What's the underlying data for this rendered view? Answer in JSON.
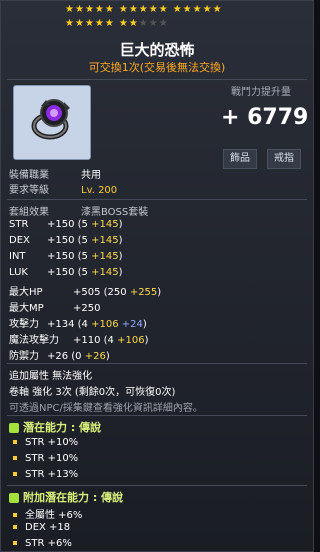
{
  "item": {
    "name": "巨大的恐怖",
    "trade_note": "可交換1次(交易後無法交換)",
    "power_label": "戰鬥力提升量",
    "power_value": "+ 6779",
    "tags": [
      "飾品",
      "戒指"
    ],
    "job_label": "裝備職業",
    "job_value": "共用",
    "level_label": "要求等級",
    "level_value": "Lv. 200"
  },
  "stars": {
    "filled": 22,
    "total": 25,
    "color": "#ffcc22"
  },
  "set": {
    "label": "套組效果",
    "name": "漆黑BOSS套裝"
  },
  "stats": [
    {
      "name": "STR",
      "text": "+150 (5 ",
      "green": "+145",
      "tail": ")"
    },
    {
      "name": "DEX",
      "text": "+150 (5 ",
      "green": "+145",
      "tail": ")"
    },
    {
      "name": "INT",
      "text": "+150 (5 ",
      "green": "+145",
      "tail": ")"
    },
    {
      "name": "LUK",
      "text": "+150 (5 ",
      "green": "+145",
      "tail": ")"
    },
    {
      "name": "最大HP",
      "text": "+505 (250 ",
      "green": "+255",
      "tail": ")"
    },
    {
      "name": "最大MP",
      "text": "+250",
      "green": "",
      "tail": ""
    },
    {
      "name": "攻擊力",
      "text": "+134 (4 ",
      "green": "+106",
      "blue": "+24",
      "tail": ")"
    },
    {
      "name": "魔法攻擊力",
      "text": "+110 (4 ",
      "green": "+106",
      "tail": ")"
    },
    {
      "name": "防禦力",
      "text": "+26 (0 ",
      "green": "+26",
      "tail": ")"
    }
  ],
  "extra": {
    "line1": "追加屬性 無法強化",
    "line2": "卷軸 強化 3次 (剩餘0次，可恢復0次)",
    "line3": "可透過NPC/採集鍵查看強化資訊詳細內容。"
  },
  "potential": {
    "header": "潛在能力 : 傳說",
    "lines": [
      "STR +10%",
      "STR +10%",
      "STR +13%"
    ]
  },
  "bonus_potential": {
    "header": "附加潛在能力 : 傳說",
    "lines": [
      "全屬性 +6%",
      "DEX +18",
      "STR +6%"
    ]
  }
}
